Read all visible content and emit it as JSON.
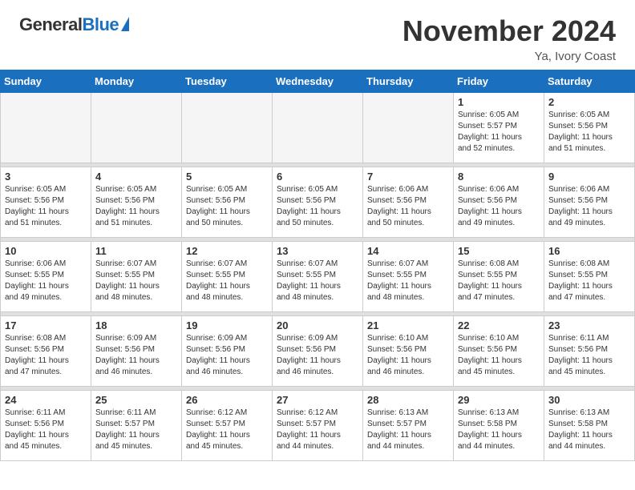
{
  "header": {
    "logo_general": "General",
    "logo_blue": "Blue",
    "month_title": "November 2024",
    "location": "Ya, Ivory Coast"
  },
  "days_of_week": [
    "Sunday",
    "Monday",
    "Tuesday",
    "Wednesday",
    "Thursday",
    "Friday",
    "Saturday"
  ],
  "weeks": [
    [
      {
        "day": "",
        "info": ""
      },
      {
        "day": "",
        "info": ""
      },
      {
        "day": "",
        "info": ""
      },
      {
        "day": "",
        "info": ""
      },
      {
        "day": "",
        "info": ""
      },
      {
        "day": "1",
        "info": "Sunrise: 6:05 AM\nSunset: 5:57 PM\nDaylight: 11 hours\nand 52 minutes."
      },
      {
        "day": "2",
        "info": "Sunrise: 6:05 AM\nSunset: 5:56 PM\nDaylight: 11 hours\nand 51 minutes."
      }
    ],
    [
      {
        "day": "3",
        "info": "Sunrise: 6:05 AM\nSunset: 5:56 PM\nDaylight: 11 hours\nand 51 minutes."
      },
      {
        "day": "4",
        "info": "Sunrise: 6:05 AM\nSunset: 5:56 PM\nDaylight: 11 hours\nand 51 minutes."
      },
      {
        "day": "5",
        "info": "Sunrise: 6:05 AM\nSunset: 5:56 PM\nDaylight: 11 hours\nand 50 minutes."
      },
      {
        "day": "6",
        "info": "Sunrise: 6:05 AM\nSunset: 5:56 PM\nDaylight: 11 hours\nand 50 minutes."
      },
      {
        "day": "7",
        "info": "Sunrise: 6:06 AM\nSunset: 5:56 PM\nDaylight: 11 hours\nand 50 minutes."
      },
      {
        "day": "8",
        "info": "Sunrise: 6:06 AM\nSunset: 5:56 PM\nDaylight: 11 hours\nand 49 minutes."
      },
      {
        "day": "9",
        "info": "Sunrise: 6:06 AM\nSunset: 5:56 PM\nDaylight: 11 hours\nand 49 minutes."
      }
    ],
    [
      {
        "day": "10",
        "info": "Sunrise: 6:06 AM\nSunset: 5:55 PM\nDaylight: 11 hours\nand 49 minutes."
      },
      {
        "day": "11",
        "info": "Sunrise: 6:07 AM\nSunset: 5:55 PM\nDaylight: 11 hours\nand 48 minutes."
      },
      {
        "day": "12",
        "info": "Sunrise: 6:07 AM\nSunset: 5:55 PM\nDaylight: 11 hours\nand 48 minutes."
      },
      {
        "day": "13",
        "info": "Sunrise: 6:07 AM\nSunset: 5:55 PM\nDaylight: 11 hours\nand 48 minutes."
      },
      {
        "day": "14",
        "info": "Sunrise: 6:07 AM\nSunset: 5:55 PM\nDaylight: 11 hours\nand 48 minutes."
      },
      {
        "day": "15",
        "info": "Sunrise: 6:08 AM\nSunset: 5:55 PM\nDaylight: 11 hours\nand 47 minutes."
      },
      {
        "day": "16",
        "info": "Sunrise: 6:08 AM\nSunset: 5:55 PM\nDaylight: 11 hours\nand 47 minutes."
      }
    ],
    [
      {
        "day": "17",
        "info": "Sunrise: 6:08 AM\nSunset: 5:56 PM\nDaylight: 11 hours\nand 47 minutes."
      },
      {
        "day": "18",
        "info": "Sunrise: 6:09 AM\nSunset: 5:56 PM\nDaylight: 11 hours\nand 46 minutes."
      },
      {
        "day": "19",
        "info": "Sunrise: 6:09 AM\nSunset: 5:56 PM\nDaylight: 11 hours\nand 46 minutes."
      },
      {
        "day": "20",
        "info": "Sunrise: 6:09 AM\nSunset: 5:56 PM\nDaylight: 11 hours\nand 46 minutes."
      },
      {
        "day": "21",
        "info": "Sunrise: 6:10 AM\nSunset: 5:56 PM\nDaylight: 11 hours\nand 46 minutes."
      },
      {
        "day": "22",
        "info": "Sunrise: 6:10 AM\nSunset: 5:56 PM\nDaylight: 11 hours\nand 45 minutes."
      },
      {
        "day": "23",
        "info": "Sunrise: 6:11 AM\nSunset: 5:56 PM\nDaylight: 11 hours\nand 45 minutes."
      }
    ],
    [
      {
        "day": "24",
        "info": "Sunrise: 6:11 AM\nSunset: 5:56 PM\nDaylight: 11 hours\nand 45 minutes."
      },
      {
        "day": "25",
        "info": "Sunrise: 6:11 AM\nSunset: 5:57 PM\nDaylight: 11 hours\nand 45 minutes."
      },
      {
        "day": "26",
        "info": "Sunrise: 6:12 AM\nSunset: 5:57 PM\nDaylight: 11 hours\nand 45 minutes."
      },
      {
        "day": "27",
        "info": "Sunrise: 6:12 AM\nSunset: 5:57 PM\nDaylight: 11 hours\nand 44 minutes."
      },
      {
        "day": "28",
        "info": "Sunrise: 6:13 AM\nSunset: 5:57 PM\nDaylight: 11 hours\nand 44 minutes."
      },
      {
        "day": "29",
        "info": "Sunrise: 6:13 AM\nSunset: 5:58 PM\nDaylight: 11 hours\nand 44 minutes."
      },
      {
        "day": "30",
        "info": "Sunrise: 6:13 AM\nSunset: 5:58 PM\nDaylight: 11 hours\nand 44 minutes."
      }
    ]
  ]
}
